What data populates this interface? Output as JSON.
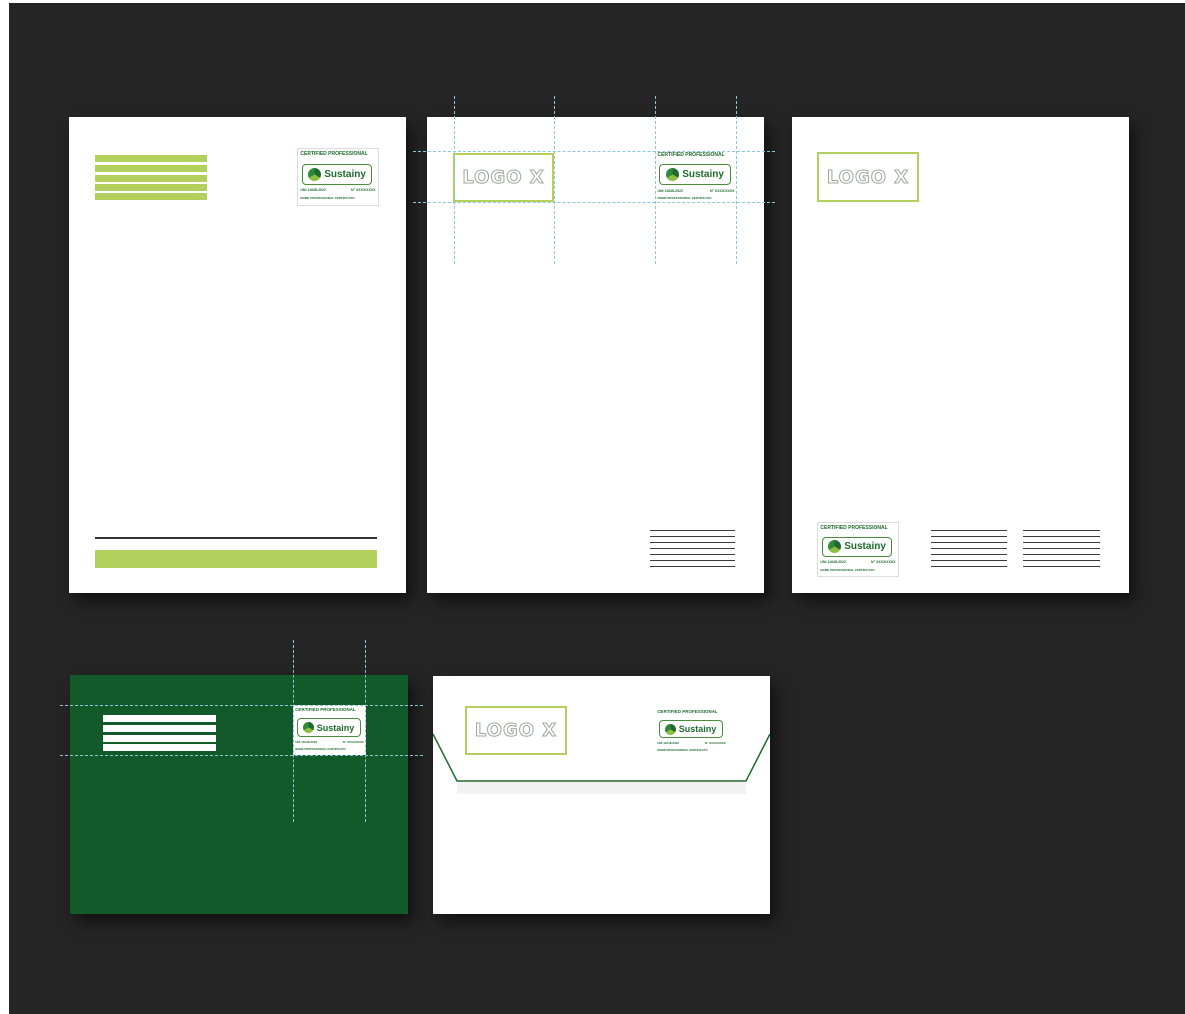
{
  "logo_placeholder": "LOGO X",
  "badge": {
    "title": "CERTIFIED PROFESSIONAL",
    "brand": "Sustainy",
    "standard": "UNI 11648-2022",
    "number": "N° XXXX/XXXX",
    "footer": "NOME PROFESSIONAL CERTIFICATO"
  },
  "colors": {
    "background": "#252525",
    "accent_lime": "#b3cf5c",
    "brand_green": "#1e6b2d",
    "envelope_green": "#135a2b",
    "guide_cyan": "#8fc6dd",
    "paper": "#ffffff"
  }
}
